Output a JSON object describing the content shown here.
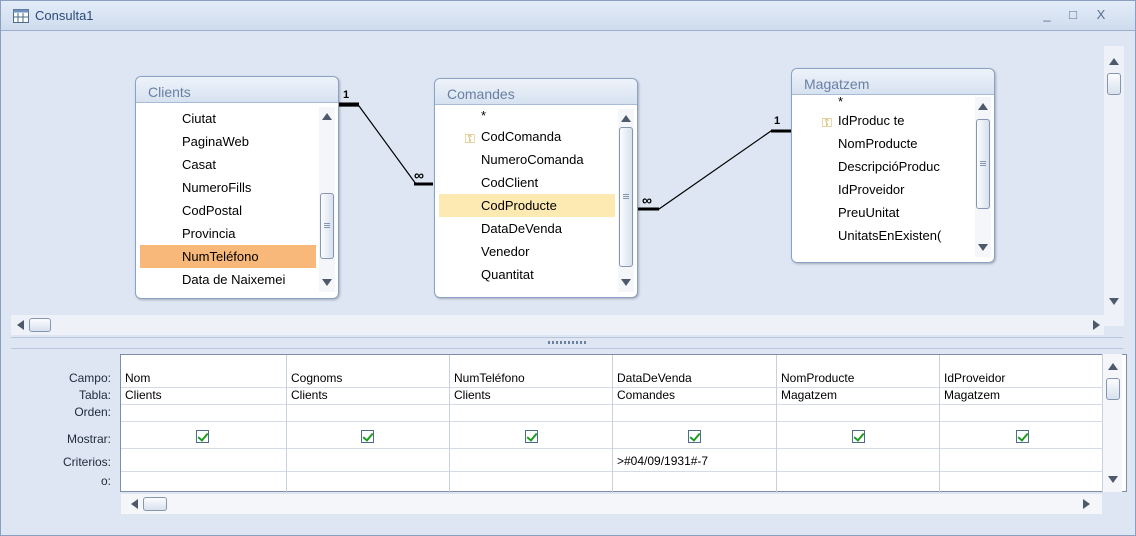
{
  "window": {
    "title": "Consulta1",
    "minimize": "_",
    "maximize": "□",
    "close": "X"
  },
  "tables": {
    "clients": {
      "title": "Clients",
      "fields": [
        "Ciutat",
        "PaginaWeb",
        "Casat",
        "NumeroFills",
        "CodPostal",
        "Provincia",
        "NumTeléfono",
        "Data de Naixemei"
      ],
      "selected": "NumTeléfono"
    },
    "comandes": {
      "title": "Comandes",
      "fields": [
        "*",
        "CodComanda",
        "NumeroComanda",
        "CodClient",
        "CodProducte",
        "DataDeVenda",
        "Venedor",
        "Quantitat"
      ],
      "key_field": "CodComanda",
      "highlighted": "CodProducte"
    },
    "magatzem": {
      "title": "Magatzem",
      "fields": [
        "*",
        "IdProduc te",
        "NomProducte",
        "DescripcióProduc",
        "IdProveidor",
        "PreuUnitat",
        "UnitatsEnExisten("
      ],
      "key_field": "IdProduc te"
    }
  },
  "relations": [
    {
      "one": "1",
      "many": "∞"
    },
    {
      "one": "1",
      "many": "∞"
    }
  ],
  "grid": {
    "row_labels": [
      "Campo:",
      "Tabla:",
      "Orden:",
      "Mostrar:",
      "Criterios:",
      "o:"
    ],
    "columns": [
      {
        "campo": "Nom",
        "tabla": "Clients",
        "mostrar": true,
        "criterios": ""
      },
      {
        "campo": "Cognoms",
        "tabla": "Clients",
        "mostrar": true,
        "criterios": ""
      },
      {
        "campo": "NumTeléfono",
        "tabla": "Clients",
        "mostrar": true,
        "criterios": ""
      },
      {
        "campo": "DataDeVenda",
        "tabla": "Comandes",
        "mostrar": true,
        "criterios": ">#04/09/1931#-7"
      },
      {
        "campo": "NomProducte",
        "tabla": "Magatzem",
        "mostrar": true,
        "criterios": ""
      },
      {
        "campo": "IdProveidor",
        "tabla": "Magatzem",
        "mostrar": true,
        "criterios": ""
      }
    ]
  }
}
